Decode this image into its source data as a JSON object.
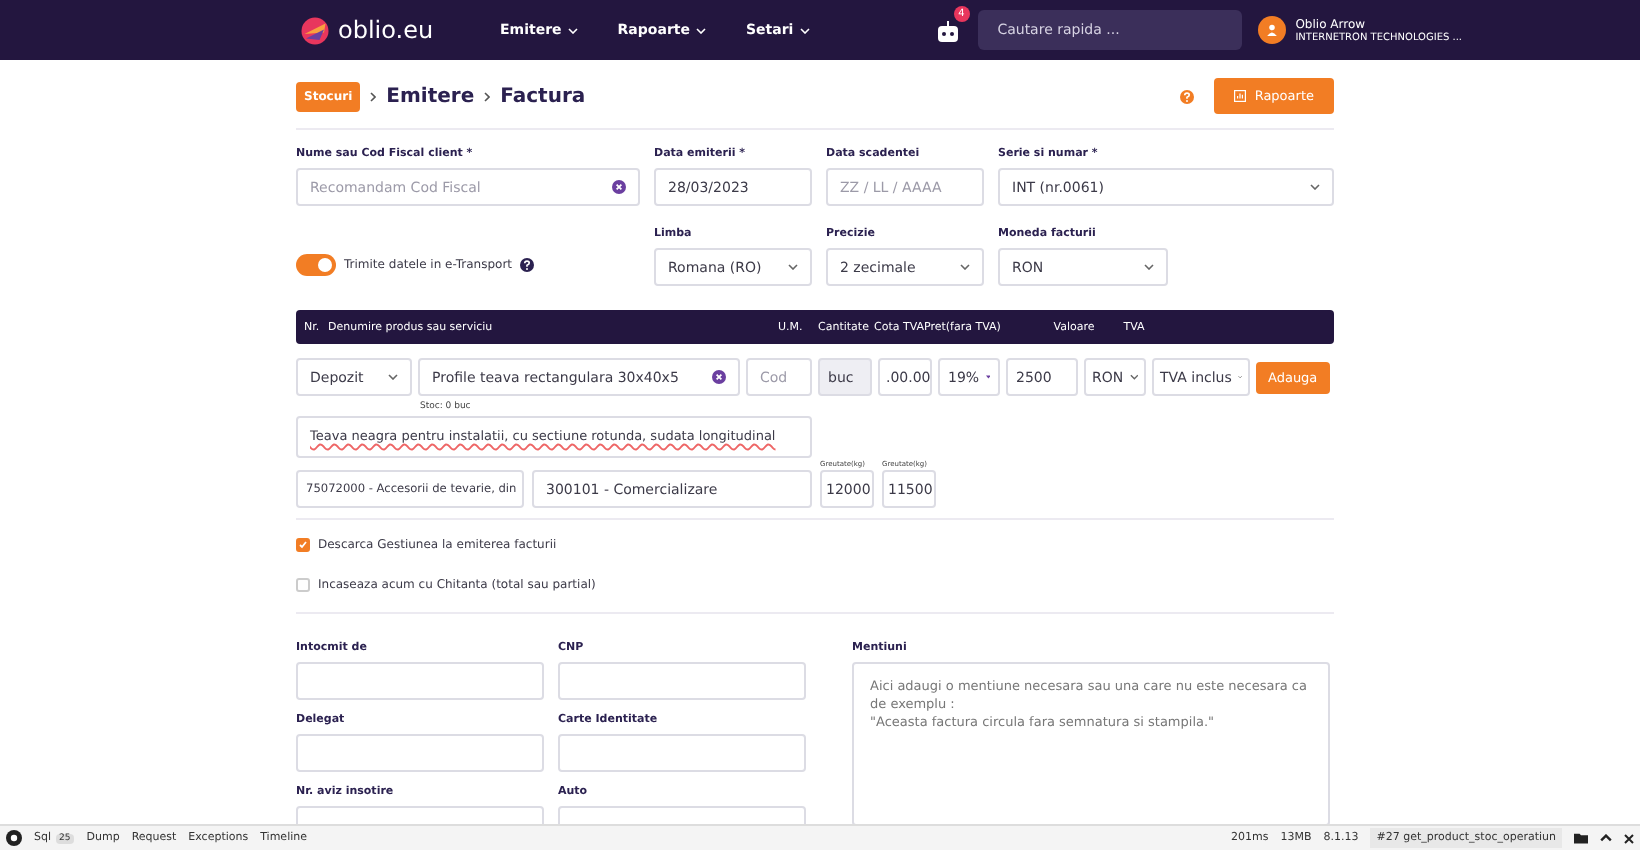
{
  "navbar": {
    "logo": "oblio.eu",
    "menu": [
      {
        "label": "Emitere"
      },
      {
        "label": "Rapoarte"
      },
      {
        "label": "Setari"
      }
    ],
    "notification_count": "4",
    "search": {
      "placeholder": "Cautare rapida ..."
    },
    "user": {
      "name": "Oblio Arrow",
      "company": "INTERNETRON TECHNOLOGIES ..."
    }
  },
  "breadcrumb": {
    "badge": "Stocuri",
    "items": [
      "Emitere",
      "Factura"
    ]
  },
  "reports_button": "Rapoarte",
  "header_fields": [
    {
      "label": "Nume sau Cod Fiscal client *",
      "kind": "clearable",
      "placeholder": "Recomandam Cod Fiscal"
    },
    {
      "label": "Data emiterii *",
      "kind": "text",
      "value": "28/03/2023"
    },
    {
      "label": "Data scadentei",
      "kind": "text",
      "placeholder": "ZZ / LL / AAAA"
    },
    {
      "label": "Serie si numar *",
      "kind": "select",
      "value": "INT (nr.0061)"
    }
  ],
  "etransport_toggle": {
    "label": "Trimite datele in e-Transport",
    "on": true
  },
  "settings_fields": [
    {
      "label": "Limba",
      "kind": "select",
      "value": "Romana (RO)"
    },
    {
      "label": "Precizie",
      "kind": "select",
      "value": "2 zecimale"
    },
    {
      "label": "Moneda facturii",
      "kind": "select",
      "value": "RON"
    }
  ],
  "table": {
    "columns": [
      "Nr.",
      "Denumire produs sau serviciu",
      "U.M.",
      "Cantitate",
      "Cota TVA",
      "Pret(fara TVA)",
      "Valoare",
      "TVA"
    ]
  },
  "item": {
    "warehouse": "Depozit",
    "product": "Profile teava rectangulara 30x40x5",
    "code_placeholder": "Cod",
    "unit": "buc",
    "quantity": ".00.00",
    "vat_rate": "19%",
    "price": "2500",
    "currency": "RON",
    "vat_mode": "TVA inclus",
    "add_button": "Adauga",
    "stock_note": "Stoc: 0 buc",
    "description": "Teava neagra pentru instalatii, cu sectiune rotunda, sudata longitudinal",
    "cpv_code": "75072000 - Accesorii de tevarie, din",
    "operation_code": "300101 - Comercializare",
    "weights": [
      {
        "label": "Greutate(kg)",
        "value": "12000"
      },
      {
        "label": "Greutate(kg)",
        "value": "11500"
      }
    ]
  },
  "options": [
    {
      "label": "Descarca Gestiunea la emiterea facturii",
      "checked": true
    },
    {
      "label": "Incaseaza acum cu Chitanta (total sau partial)",
      "checked": false
    }
  ],
  "extra_fields": [
    {
      "label": "Intocmit de"
    },
    {
      "label": "CNP"
    },
    {
      "label": "Delegat"
    },
    {
      "label": "Carte Identitate"
    },
    {
      "label": "Nr. aviz insotire"
    },
    {
      "label": "Auto"
    }
  ],
  "notes": {
    "label": "Mentiuni",
    "placeholder": "Aici adaugi o mentiune necesara sau una care nu este necesara ca de exemplu :\n\"Aceasta factura circula fara semnatura si stampila.\""
  },
  "debug_bar": {
    "tabs": [
      {
        "label": "Sql",
        "count": "25"
      },
      {
        "label": "Dump"
      },
      {
        "label": "Request"
      },
      {
        "label": "Exceptions"
      },
      {
        "label": "Timeline"
      }
    ],
    "time": "201ms",
    "memory": "13MB",
    "version": "8.1.13",
    "request": "#27 get_product_stoc_operatiun"
  }
}
